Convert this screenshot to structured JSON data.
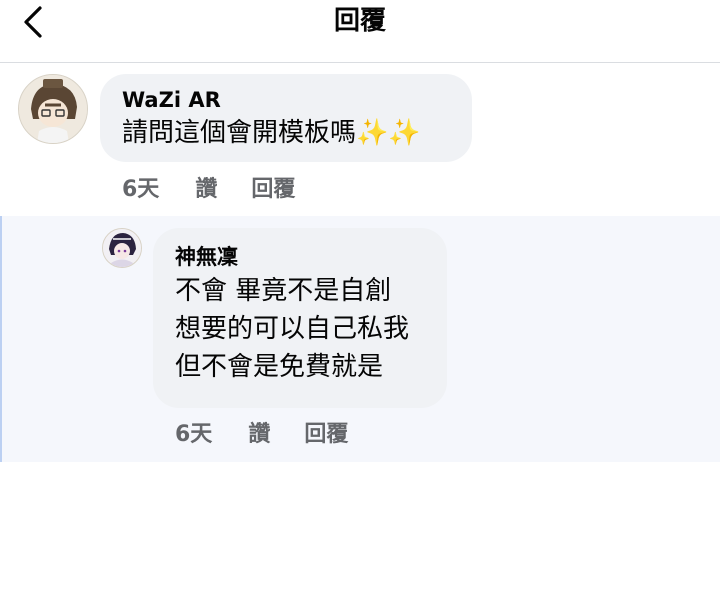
{
  "header": {
    "title": "回覆",
    "back_icon": "chevron-left-icon"
  },
  "comments": [
    {
      "author": "WaZi AR",
      "lines": [
        "請問這個會開模板嗎"
      ],
      "emoji": "✨✨",
      "time": "6天",
      "like_label": "讚",
      "reply_label": "回覆"
    },
    {
      "author": "神無凜",
      "lines": [
        "不會 畢竟不是自創",
        "想要的可以自己私我",
        "但不會是免費就是"
      ],
      "time": "6天",
      "like_label": "讚",
      "reply_label": "回覆"
    }
  ],
  "colors": {
    "bubble": "#f0f2f5",
    "meta_text": "#65676b",
    "reply_band": "#f5f7fc",
    "reply_border": "#bcd0f2"
  }
}
